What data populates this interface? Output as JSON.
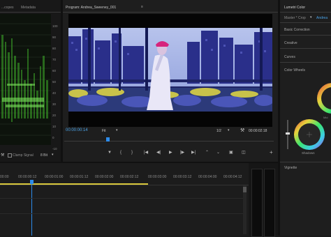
{
  "scopes_panel": {
    "tab_scopes": "...copes",
    "tab_metadata": "Metadata",
    "scale_labels": [
      "100",
      "90",
      "80",
      "70",
      "60",
      "50",
      "40",
      "30",
      "20",
      "10",
      "0",
      "-10"
    ],
    "clamp_signal_label": "Clamp Signal",
    "bit_depth": "8 Bit"
  },
  "program_monitor": {
    "title": "Program: Andrea_Sweeney_001",
    "timecode_current": "00:00:00:14",
    "fit_label": "Fit",
    "resolution": "1/2",
    "timecode_duration": "00:00:02:18"
  },
  "lumetri": {
    "title": "Lumetri Color",
    "master_label": "Master * Crop",
    "clip_label": "Andrea",
    "sections": [
      "Basic Correction",
      "Creative",
      "Curves",
      "Color Wheels"
    ],
    "midtones_label": "Mid",
    "shadows_label": "Shadows",
    "vignette_label": "Vignette"
  },
  "timeline": {
    "ruler_times": [
      "00:00",
      "00:00:00:12",
      "00:00:01:00",
      "00:00:01:12",
      "00:00:02:00",
      "00:00:02:12",
      "00:00:03:00",
      "00:00:03:12",
      "00:00:04:00",
      "00:00:04:12"
    ]
  },
  "colors": {
    "accent_blue": "#4aa3e8",
    "playhead_blue": "#2d8ceb",
    "waveform_green": "#3fae2a",
    "work_area_yellow": "#d8c83c"
  }
}
